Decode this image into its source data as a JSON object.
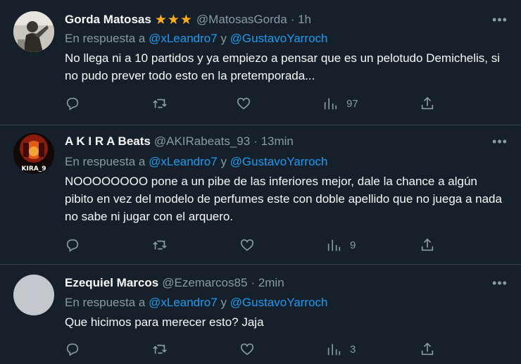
{
  "tweets": [
    {
      "name": "Gorda Matosas",
      "stars": "★★★",
      "handle": "@MatosasGorda",
      "time": "· 1h",
      "reply_prefix": "En respuesta a",
      "reply_user1": "@xLeandro7",
      "reply_and": "y",
      "reply_user2": "@GustavoYarroch",
      "text": "No llega ni a 10 partidos y ya empiezo a pensar que es un pelotudo Demichelis, si no pudo prever todo esto en la pretemporada...",
      "views": "97"
    },
    {
      "name": "A K I R A Beats",
      "handle": "@AKIRabeats_93",
      "time": "· 13min",
      "reply_prefix": "En respuesta a",
      "reply_user1": "@xLeandro7",
      "reply_and": "y",
      "reply_user2": "@GustavoYarroch",
      "text": "NOOOOOOOO pone a un pibe de las inferiores mejor, dale la chance a algún pibito en vez del modelo de perfumes este con doble apellido que no juega a nada no sabe ni jugar con el arquero.",
      "views": "9",
      "avatar_text": "KIRA_9"
    },
    {
      "name": "Ezequiel Marcos",
      "handle": "@Ezemarcos85",
      "time": "· 2min",
      "reply_prefix": "En respuesta a",
      "reply_user1": "@xLeandro7",
      "reply_and": "y",
      "reply_user2": "@GustavoYarroch",
      "text": "Que hicimos para merecer esto? Jaja",
      "views": "3"
    }
  ],
  "more_icon": "more-horizontal-icon",
  "colors": {
    "background": "#15202b",
    "text": "#f7f9f9",
    "muted": "#8b98a5",
    "link": "#1d9bf0",
    "star": "#ffad1f",
    "divider": "#38444d"
  }
}
